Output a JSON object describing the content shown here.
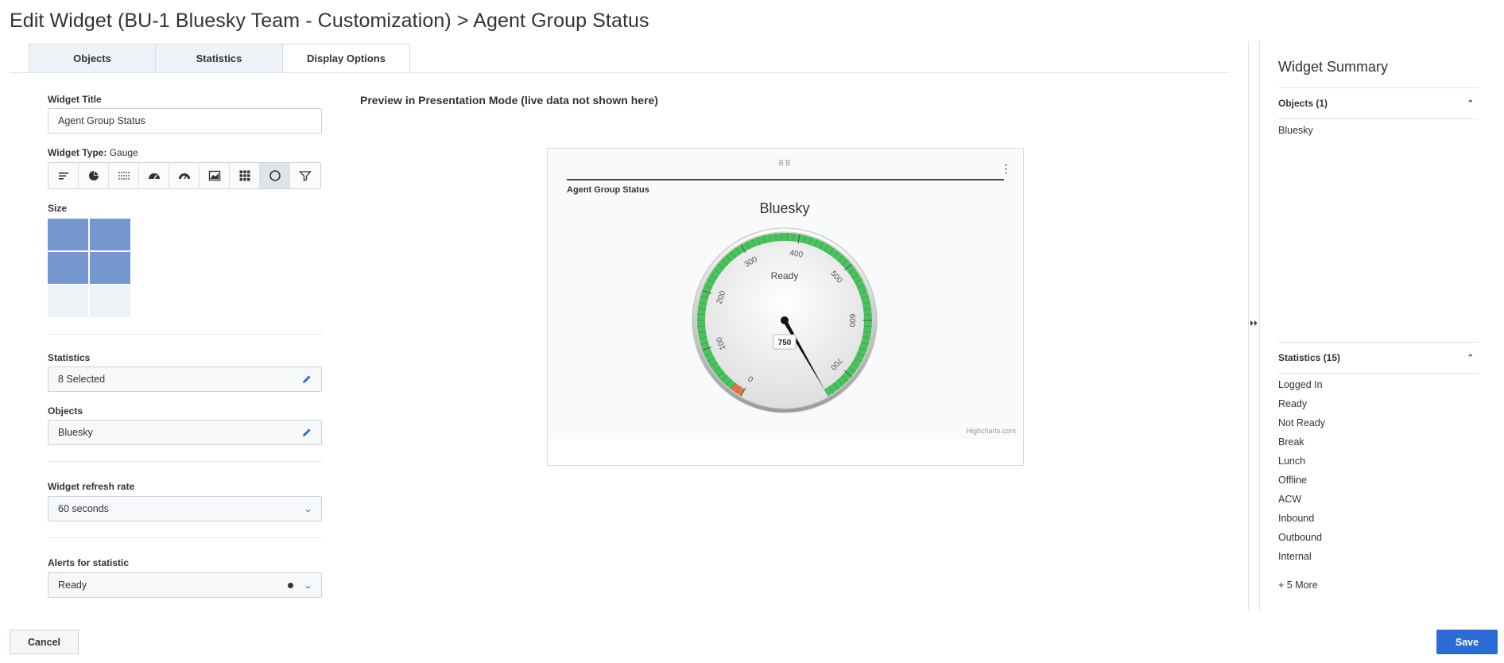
{
  "page": {
    "title": "Edit Widget (BU-1 Bluesky Team - Customization) > Agent Group Status"
  },
  "tabs": [
    {
      "label": "Objects",
      "active": false
    },
    {
      "label": "Statistics",
      "active": false
    },
    {
      "label": "Display Options",
      "active": true
    }
  ],
  "form": {
    "widget_title_label": "Widget Title",
    "widget_title_value": "Agent Group Status",
    "widget_type_label": "Widget Type:",
    "widget_type_value": "Gauge",
    "widget_types": [
      "bar-chart",
      "pie-chart",
      "dot-matrix",
      "gauge-half",
      "gauge-speed",
      "line-chart",
      "grid",
      "gauge-circle",
      "funnel"
    ],
    "selected_type": "gauge-circle",
    "size_label": "Size",
    "size_selected": "2 x 2",
    "statistics_label": "Statistics",
    "statistics_value": "8 Selected",
    "objects_label": "Objects",
    "objects_value": "Bluesky",
    "refresh_label": "Widget refresh rate",
    "refresh_value": "60 seconds",
    "alerts_label": "Alerts for statistic",
    "alerts_value": "Ready"
  },
  "preview": {
    "label": "Preview in Presentation Mode (live data not shown here)",
    "card_title": "Agent Group Status",
    "chart_title": "Bluesky",
    "credits": "Highcharts.com"
  },
  "chart_data": {
    "type": "gauge",
    "title": "Bluesky",
    "series_label": "Ready",
    "value": 750,
    "min": 0,
    "max": 750,
    "ticks": [
      0,
      100,
      200,
      300,
      400,
      500,
      600,
      700
    ],
    "bands": [
      {
        "from": 0,
        "to": 20,
        "color": "#e8734a"
      },
      {
        "from": 20,
        "to": 750,
        "color": "#4cc25f"
      }
    ]
  },
  "summary": {
    "title": "Widget Summary",
    "objects_header": "Objects (1)",
    "objects": [
      "Bluesky"
    ],
    "statistics_header": "Statistics (15)",
    "statistics": [
      "Logged In",
      "Ready",
      "Not Ready",
      "Break",
      "Lunch",
      "Offline",
      "ACW",
      "Inbound",
      "Outbound",
      "Internal"
    ],
    "more": "+ 5 More"
  },
  "buttons": {
    "cancel": "Cancel",
    "save": "Save"
  },
  "colors": {
    "accent": "#2c6bd4",
    "size_selected": "#7597cf",
    "gauge_band": "#4cc25f"
  }
}
